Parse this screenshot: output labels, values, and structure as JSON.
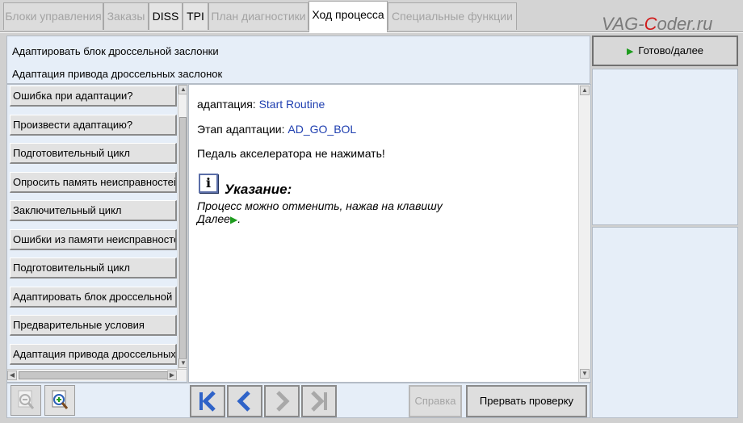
{
  "tabs": [
    {
      "label": "Блоки управления",
      "state": "disabled"
    },
    {
      "label": "Заказы",
      "state": "disabled"
    },
    {
      "label": "DISS",
      "state": "enabled"
    },
    {
      "label": "TPI",
      "state": "enabled"
    },
    {
      "label": "План диагностики",
      "state": "disabled"
    },
    {
      "label": "Ход процесса",
      "state": "active"
    },
    {
      "label": "Специальные функции",
      "state": "disabled"
    }
  ],
  "logo": {
    "prefix": "VAG-",
    "highlight": "C",
    "suffix": "oder.ru"
  },
  "header": {
    "line1": "Адаптировать блок дроссельной заслонки",
    "line2": "Адаптация привода дроссельных заслонок"
  },
  "steps": [
    "Ошибка при адаптации?",
    "Произвести адаптацию?",
    "Подготовительный цикл",
    "Опросить память неисправностей",
    "Заключительный цикл",
    "Ошибки из памяти неисправностей",
    "Подготовительный цикл",
    "Адаптировать блок дроссельной заслонки",
    "Предварительные условия",
    "Адаптация привода дроссельных заслонок"
  ],
  "content": {
    "adaptation_label": "адаптация: ",
    "adaptation_value": "Start Routine",
    "stage_label": "Этап адаптации: ",
    "stage_value": "AD_GO_BOL",
    "instruction": "Педаль акселератора не нажимать!",
    "info_icon_glyph": "i",
    "note_heading": "Указание:",
    "note_line1": "Процесс можно отменить, нажав на клавишу",
    "note_line2": "Далее",
    "note_end": "."
  },
  "right": {
    "ready_label": "Готово/далее"
  },
  "toolbar": {
    "help_label": "Справка",
    "abort_label": "Прервать проверку"
  },
  "colors": {
    "accent_green": "#1f9c1f",
    "value_blue": "#1f3fb0",
    "panel_bg": "#e6eef8",
    "nav_blue": "#2f63c8"
  },
  "icons": {
    "zoom_out": "zoom-out-icon",
    "zoom_in": "zoom-in-icon",
    "first": "skip-first-icon",
    "back": "chevron-left-icon",
    "forward": "chevron-right-icon",
    "last": "skip-last-icon"
  }
}
